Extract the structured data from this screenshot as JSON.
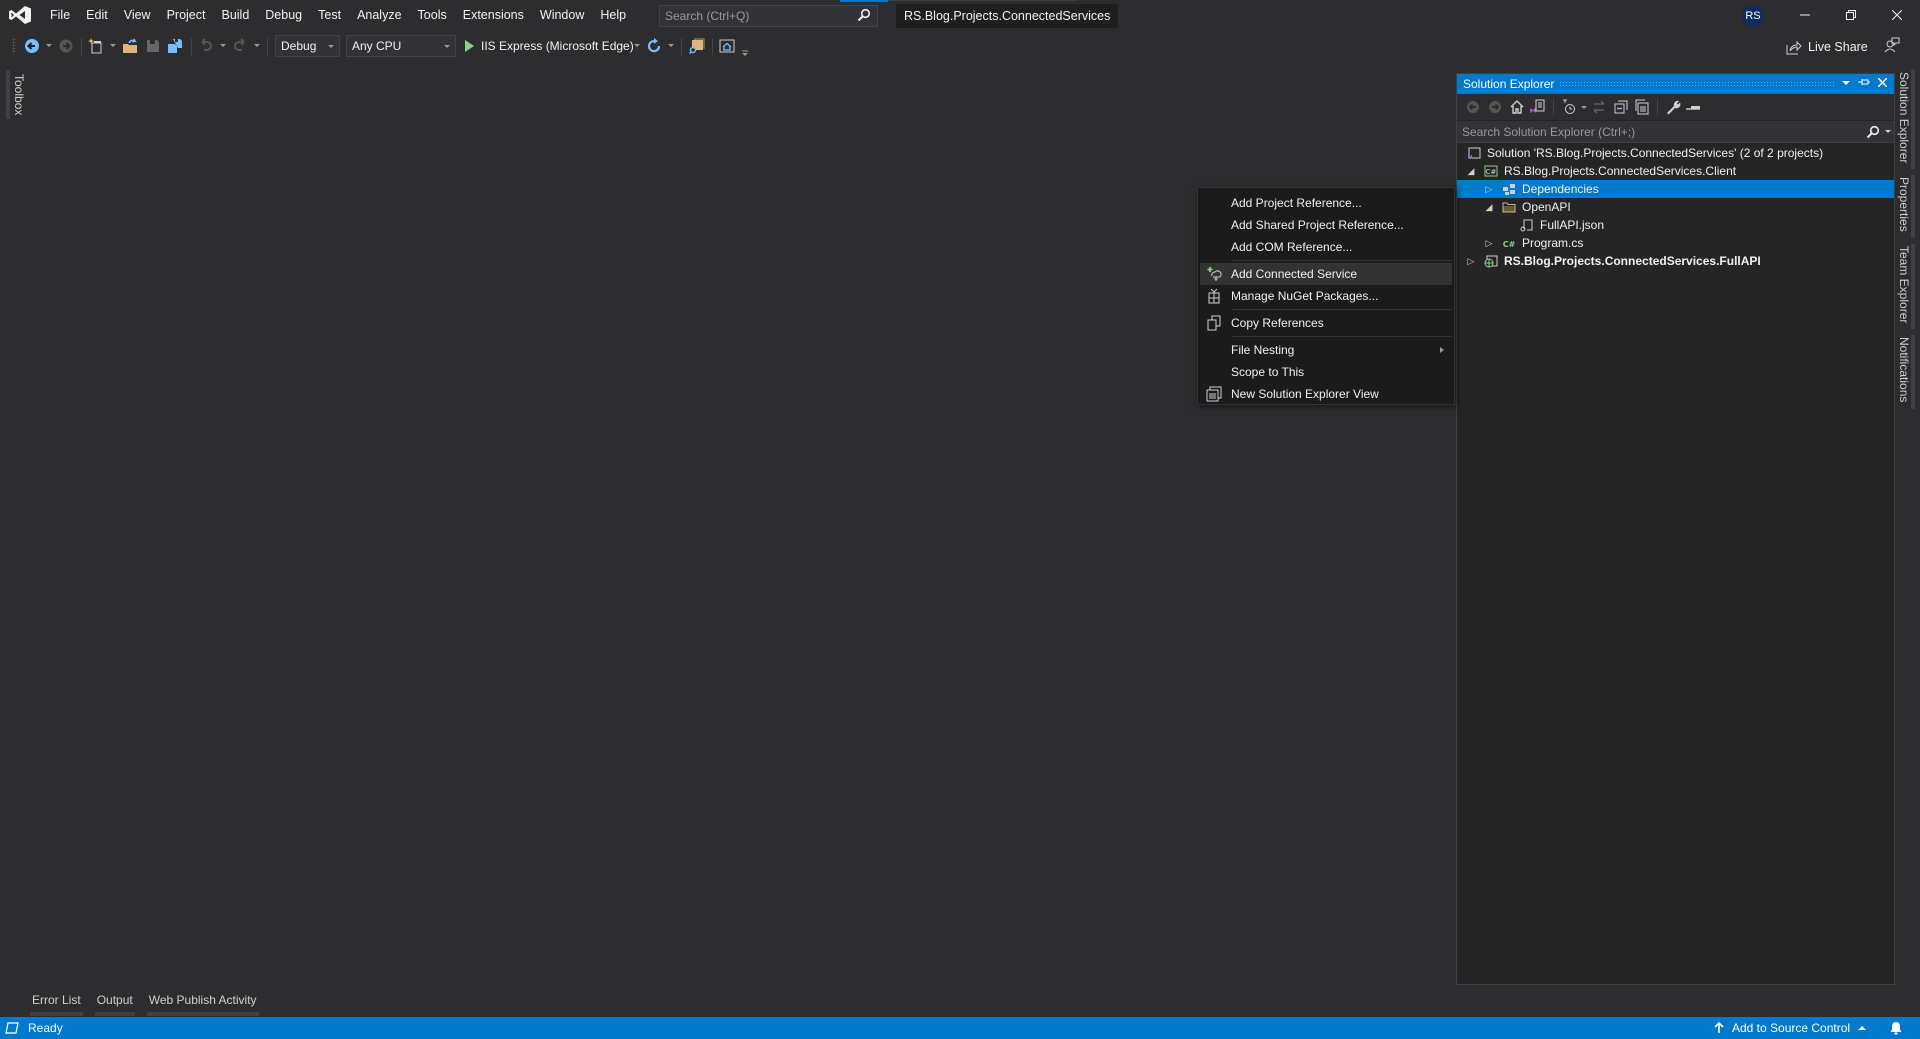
{
  "titlebar": {
    "menu": [
      "File",
      "Edit",
      "View",
      "Project",
      "Build",
      "Debug",
      "Test",
      "Analyze",
      "Tools",
      "Extensions",
      "Window",
      "Help"
    ],
    "search_placeholder": "Search (Ctrl+Q)",
    "solution_name": "RS.Blog.Projects.ConnectedServices",
    "avatar_initials": "RS",
    "window_controls": [
      "minimize-icon",
      "restore-icon",
      "close-icon"
    ]
  },
  "toolbar": {
    "configuration": "Debug",
    "platform": "Any CPU",
    "run_target": "IIS Express (Microsoft Edge)",
    "live_share_label": "Live Share"
  },
  "left_tabs": [
    "Toolbox"
  ],
  "right_tabs": [
    "Solution Explorer",
    "Properties",
    "Team Explorer",
    "Notifications"
  ],
  "solution_explorer": {
    "title": "Solution Explorer",
    "search_placeholder": "Search Solution Explorer (Ctrl+;)",
    "tree": [
      {
        "label": "Solution 'RS.Blog.Projects.ConnectedServices' (2 of 2 projects)",
        "icon": "solution-icon",
        "level": 0,
        "expander": "none",
        "bold": false,
        "selected": false
      },
      {
        "label": "RS.Blog.Projects.ConnectedServices.Client",
        "icon": "csharp-project-icon",
        "level": 1,
        "expander": "expanded",
        "bold": false,
        "selected": false
      },
      {
        "label": "Dependencies",
        "icon": "dependencies-icon",
        "level": 2,
        "expander": "collapsed",
        "bold": false,
        "selected": true
      },
      {
        "label": "OpenAPI",
        "icon": "folder-icon",
        "level": 2,
        "expander": "expanded",
        "bold": false,
        "selected": false
      },
      {
        "label": "FullAPI.json",
        "icon": "openapi-file-icon",
        "level": 3,
        "expander": "none",
        "bold": false,
        "selected": false
      },
      {
        "label": "Program.cs",
        "icon": "csharp-file-icon",
        "level": 2,
        "expander": "collapsed",
        "bold": false,
        "selected": false
      },
      {
        "label": "RS.Blog.Projects.ConnectedServices.FullAPI",
        "icon": "web-project-icon",
        "level": 1,
        "expander": "collapsed",
        "bold": true,
        "selected": false
      }
    ]
  },
  "context_menu": {
    "items": [
      {
        "label": "Add Project Reference...",
        "icon": null
      },
      {
        "label": "Add Shared Project Reference...",
        "icon": null
      },
      {
        "label": "Add COM Reference...",
        "icon": null
      },
      {
        "separator": true
      },
      {
        "label": "Add Connected Service",
        "icon": "add-connected-service-icon",
        "hover": true
      },
      {
        "label": "Manage NuGet Packages...",
        "icon": "nuget-package-icon"
      },
      {
        "separator": true
      },
      {
        "label": "Copy References",
        "icon": "copy-icon"
      },
      {
        "separator": true
      },
      {
        "label": "File Nesting",
        "icon": null,
        "submenu": true
      },
      {
        "label": "Scope to This",
        "icon": null
      },
      {
        "label": "New Solution Explorer View",
        "icon": "new-view-icon"
      }
    ]
  },
  "bottom_tabs": [
    "Error List",
    "Output",
    "Web Publish Activity"
  ],
  "statusbar": {
    "status": "Ready",
    "source_control": "Add to Source Control"
  },
  "colors": {
    "accent": "#007acc",
    "background": "#2d2d30",
    "panel": "#252526",
    "menu": "#1b1b1c"
  }
}
